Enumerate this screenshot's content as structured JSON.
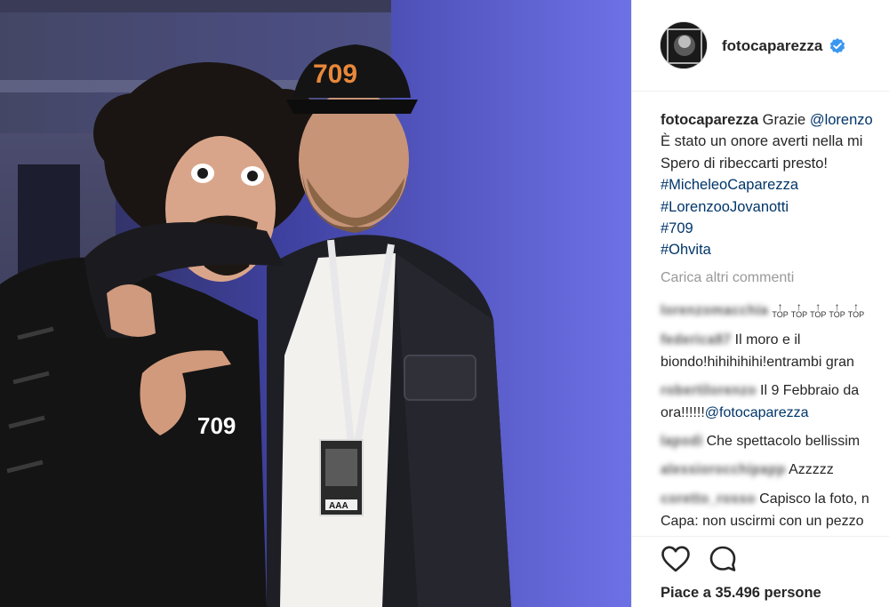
{
  "post": {
    "author": "fotocaparezza",
    "verified": true,
    "caption": {
      "username": "fotocaparezza",
      "first_line": "Grazie",
      "mention": "@lorenzo",
      "line2": "È stato un onore averti nella mi",
      "line3": "Spero di ribeccarti presto!",
      "hashtags": [
        "#MicheleoCaparezza",
        "#LorenzooJovanotti",
        "#709",
        "#Ohvita"
      ]
    },
    "load_more": "Carica altri commenti",
    "comments": [
      {
        "username": "lorenzomacchia",
        "text": "TOP TOP TOP TOP TOP"
      },
      {
        "username": "federica87",
        "line1": "Il moro e il",
        "line2": "biondo!hihihihihi!entrambi gran"
      },
      {
        "username": "robertilorenzo",
        "line1": "Il 9 Febbraio da",
        "line2": "ora!!!!!!",
        "mention": "@fotocaparezza"
      },
      {
        "username": "lapodi",
        "text": "Che spettacolo bellissim"
      },
      {
        "username": "alessiorocchipapp",
        "text": "Azzzzz"
      },
      {
        "username": "coretto_rosso",
        "line1": "Capisco la foto, n",
        "line2": "Capa: non uscirmi con un pezzo"
      }
    ],
    "likes_text": "Piace a 35.496 persone"
  },
  "photo": {
    "cap_text": "709",
    "shirt_text": "709",
    "badge_text": "AAA"
  },
  "colors": {
    "link": "#003569",
    "muted": "#999999",
    "text": "#262626",
    "verified": "#3897f0",
    "background_wall": "#5557c4"
  },
  "icons": {
    "like": "heart-outline-icon",
    "comment": "speech-bubble-icon",
    "verified": "verified-badge-icon"
  }
}
